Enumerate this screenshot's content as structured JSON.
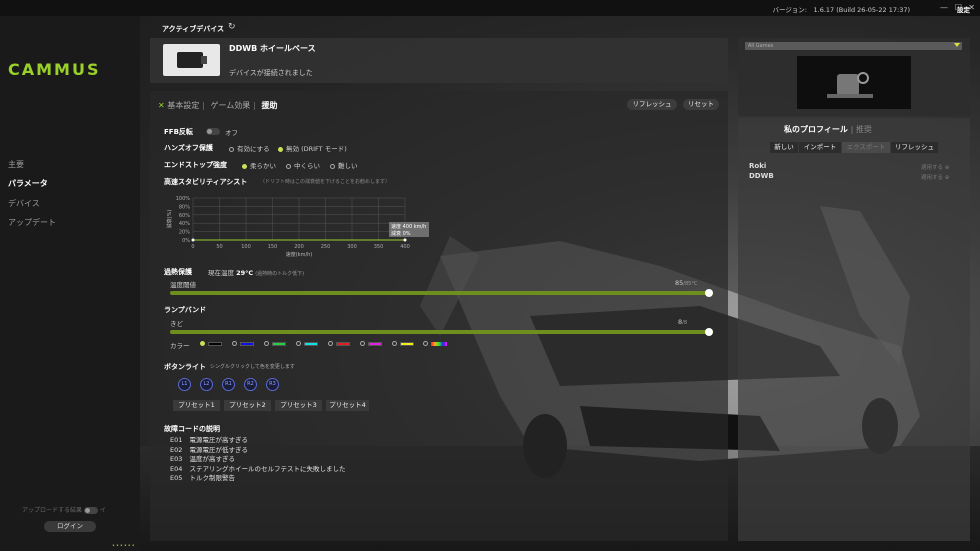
{
  "titlebar": {
    "version": "バージョン:　1.6.17 (Build 26-05-22 17:37)",
    "settings": "設定"
  },
  "sidebar": {
    "logo": "CAMMUS",
    "nav": [
      {
        "label": "主要",
        "active": false
      },
      {
        "label": "パラメータ",
        "active": true
      },
      {
        "label": "デバイス",
        "active": false
      },
      {
        "label": "アップデート",
        "active": false
      }
    ],
    "upgrade_label": "アップロードする結果",
    "upgrade_toggle_label": "イ",
    "login": "ログイン"
  },
  "active_device": {
    "label": "アクティブデバイス"
  },
  "device": {
    "name": "DDWB ホイールベース",
    "status": "デバイスが接続されました"
  },
  "tabs": {
    "basic": "基本設定",
    "game": "ゲーム効果",
    "assist": "援助",
    "refresh": "リフレッシュ",
    "reset": "リセット"
  },
  "ffb": {
    "label": "FFB反転",
    "value": "オフ"
  },
  "handsoff": {
    "label": "ハンズオフ保護",
    "options": [
      "有効にする",
      "無効 (DRIFT モード)"
    ],
    "selected": 1
  },
  "endstop": {
    "label": "エンドストップ強度",
    "options": [
      "柔らかい",
      "中くらい",
      "難しい"
    ],
    "selected": 0
  },
  "hsa": {
    "label": "高速スタビリティアシスト",
    "hint": "（ドリフト時はこの減衰値を下げることをお勧めします）",
    "chart_data": {
      "type": "line",
      "x": [
        0,
        400
      ],
      "y": [
        0,
        0
      ],
      "xticks": [
        0,
        50,
        100,
        150,
        200,
        250,
        300,
        350,
        400
      ],
      "yticks": [
        "100%",
        "80%",
        "60%",
        "40%",
        "20%",
        "0%"
      ],
      "xlabel": "速度(km/h)",
      "ylabel": "減衰(%)",
      "ylim": [
        0,
        100
      ],
      "tooltip_speed": "速度 400 km/h",
      "tooltip_damp": "減衰 0%"
    }
  },
  "overheat": {
    "label": "過熱保護",
    "current_label": "現在温度",
    "current_value": "29°C",
    "current_hint": "(過熱時のトルク低下)",
    "threshold_label": "温度閾値",
    "threshold_value": "85",
    "threshold_unit": "/85°C",
    "threshold_fraction": 1.0
  },
  "lamp": {
    "label": "ランプバンド",
    "brightness_label": "きど",
    "brightness_value": "8",
    "brightness_unit": "/8",
    "brightness_fraction": 1.0,
    "color_label": "カラー",
    "colors": [
      "#000000",
      "#1010e0",
      "#20d040",
      "#10e0e0",
      "#e02020",
      "#e020e0",
      "#f0f020"
    ]
  },
  "buttonlight": {
    "label": "ボタンライト",
    "hint": "シングルクリックして色を変更します",
    "buttons": [
      "L1",
      "L2",
      "R1",
      "R2",
      "R3"
    ],
    "presets": [
      "プリセット1",
      "プリセット2",
      "プリセット3",
      "プリセット4"
    ]
  },
  "faults": {
    "label": "故障コードの説明",
    "items": [
      {
        "code": "E01",
        "desc": "電源電圧が高すぎる"
      },
      {
        "code": "E02",
        "desc": "電源電圧が低すぎる"
      },
      {
        "code": "E03",
        "desc": "温度が高すぎる"
      },
      {
        "code": "E04",
        "desc": "ステアリングホイールのセルフテストに失敗しました"
      },
      {
        "code": "E05",
        "desc": "トルク制限警告"
      }
    ]
  },
  "game": {
    "selected": "All Games"
  },
  "profile": {
    "title": "私のプロフィール",
    "title_dim": "推奨",
    "buttons": [
      "新しい",
      "インポート",
      "エクスポート",
      "リフレッシュ"
    ],
    "items": [
      {
        "name": "Roki",
        "apply": "適用する"
      },
      {
        "name": "DDWB",
        "apply": "適用する"
      }
    ]
  }
}
